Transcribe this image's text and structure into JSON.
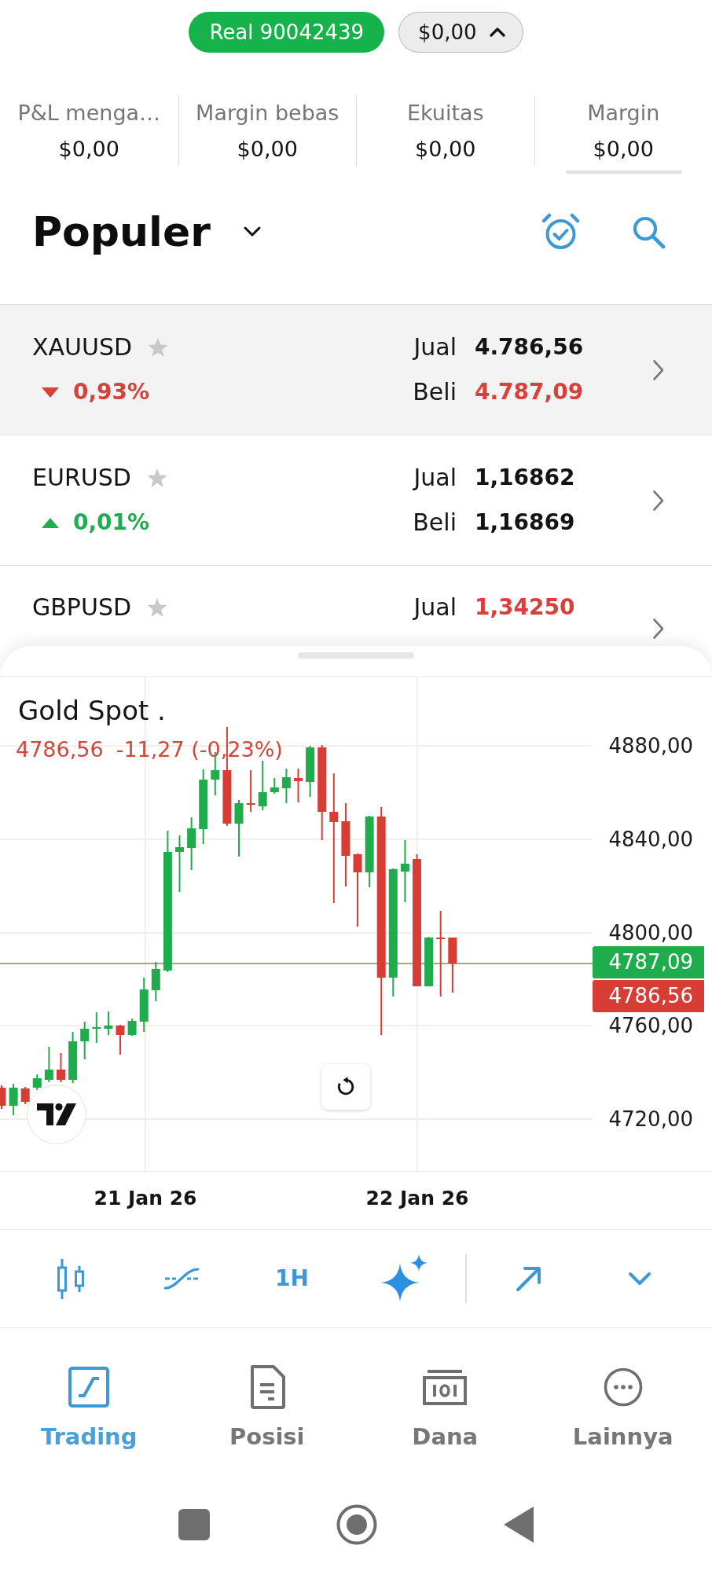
{
  "account": {
    "name": "Real 90042439",
    "balance": "$0,00",
    "expanded": true
  },
  "summary": [
    {
      "label": "P&L menga…",
      "value": "$0,00"
    },
    {
      "label": "Margin bebas",
      "value": "$0,00"
    },
    {
      "label": "Ekuitas",
      "value": "$0,00"
    },
    {
      "label": "Margin",
      "value": "$0,00"
    }
  ],
  "watchlist": {
    "title": "Populer"
  },
  "instruments": [
    {
      "symbol": "XAUUSD",
      "favorite": false,
      "selected": true,
      "change": {
        "rising": false,
        "text": "0,93%"
      },
      "quotes": [
        {
          "label": "Jual",
          "value": "4.786,56",
          "falling": false
        },
        {
          "label": "Beli",
          "value": "4.787,09",
          "falling": true
        }
      ]
    },
    {
      "symbol": "EURUSD",
      "favorite": false,
      "selected": false,
      "change": {
        "rising": true,
        "text": "0,01%"
      },
      "quotes": [
        {
          "label": "Jual",
          "value": "1,16862",
          "falling": false
        },
        {
          "label": "Beli",
          "value": "1,16869",
          "falling": false
        }
      ]
    },
    {
      "symbol": "GBPUSD",
      "favorite": false,
      "selected": false,
      "quotes": [
        {
          "label": "Jual",
          "value": "1,34250",
          "falling": true
        }
      ]
    }
  ],
  "chart": {
    "title": "Gold Spot .",
    "price": "4786,56",
    "change": "-11,27 (-0,23%)",
    "y_axis": [
      "4880,00",
      "4840,00",
      "4800,00",
      "4760,00",
      "4720,00"
    ],
    "price_tags": [
      {
        "kind": "buy",
        "text": "4787,09"
      },
      {
        "kind": "sell",
        "text": "4786,56"
      }
    ],
    "x_axis": [
      "21 Jan 26",
      "22 Jan 26"
    ]
  },
  "chart_toolbar": {
    "interval": "1H"
  },
  "nav": [
    {
      "label": "Trading",
      "selected": true
    },
    {
      "label": "Posisi",
      "selected": false
    },
    {
      "label": "Dana",
      "selected": false
    },
    {
      "label": "Lainnya",
      "selected": false
    }
  ]
}
